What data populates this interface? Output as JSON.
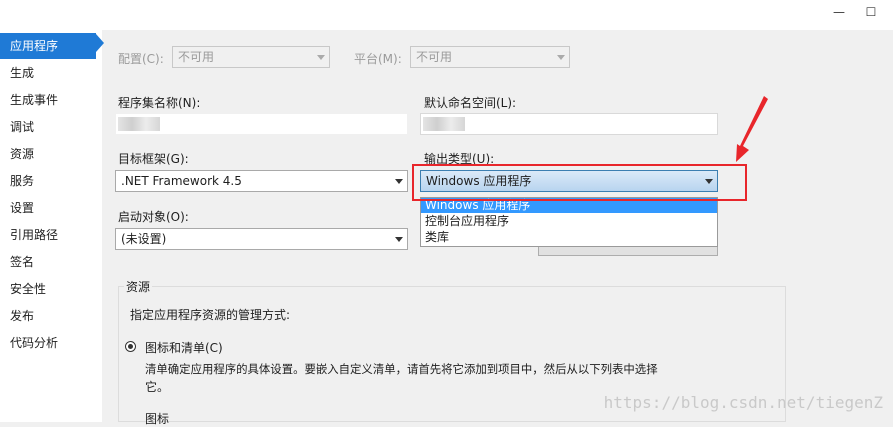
{
  "window": {
    "minimize_glyph": "—",
    "maximize_glyph": "☐"
  },
  "sidebar": {
    "items": [
      {
        "label": "应用程序"
      },
      {
        "label": "生成"
      },
      {
        "label": "生成事件"
      },
      {
        "label": "调试"
      },
      {
        "label": "资源"
      },
      {
        "label": "服务"
      },
      {
        "label": "设置"
      },
      {
        "label": "引用路径"
      },
      {
        "label": "签名"
      },
      {
        "label": "安全性"
      },
      {
        "label": "发布"
      },
      {
        "label": "代码分析"
      }
    ]
  },
  "config": {
    "config_label": "配置(C):",
    "config_value": "不可用",
    "platform_label": "平台(M):",
    "platform_value": "不可用"
  },
  "assembly": {
    "label": "程序集名称(N):"
  },
  "namespace": {
    "label": "默认命名空间(L):"
  },
  "framework": {
    "label": "目标框架(G):",
    "value": ".NET Framework 4.5"
  },
  "output": {
    "label": "输出类型(U):",
    "value": "Windows 应用程序",
    "options": [
      "Windows 应用程序",
      "控制台应用程序",
      "类库"
    ]
  },
  "startup": {
    "label": "启动对象(O):",
    "value": "(未设置)"
  },
  "resources": {
    "group_title": "资源",
    "instruction": "指定应用程序资源的管理方式:",
    "radio_label": "图标和清单(C)",
    "description_line1": "清单确定应用程序的具体设置。要嵌入自定义清单，请首先将它添加到项目中，然后从以下列表中选择",
    "description_line2": "它。",
    "cutoff_label": "图标"
  },
  "annotation": {
    "color": "#e8262b"
  },
  "watermark": "https://blog.csdn.net/tiegenZ"
}
